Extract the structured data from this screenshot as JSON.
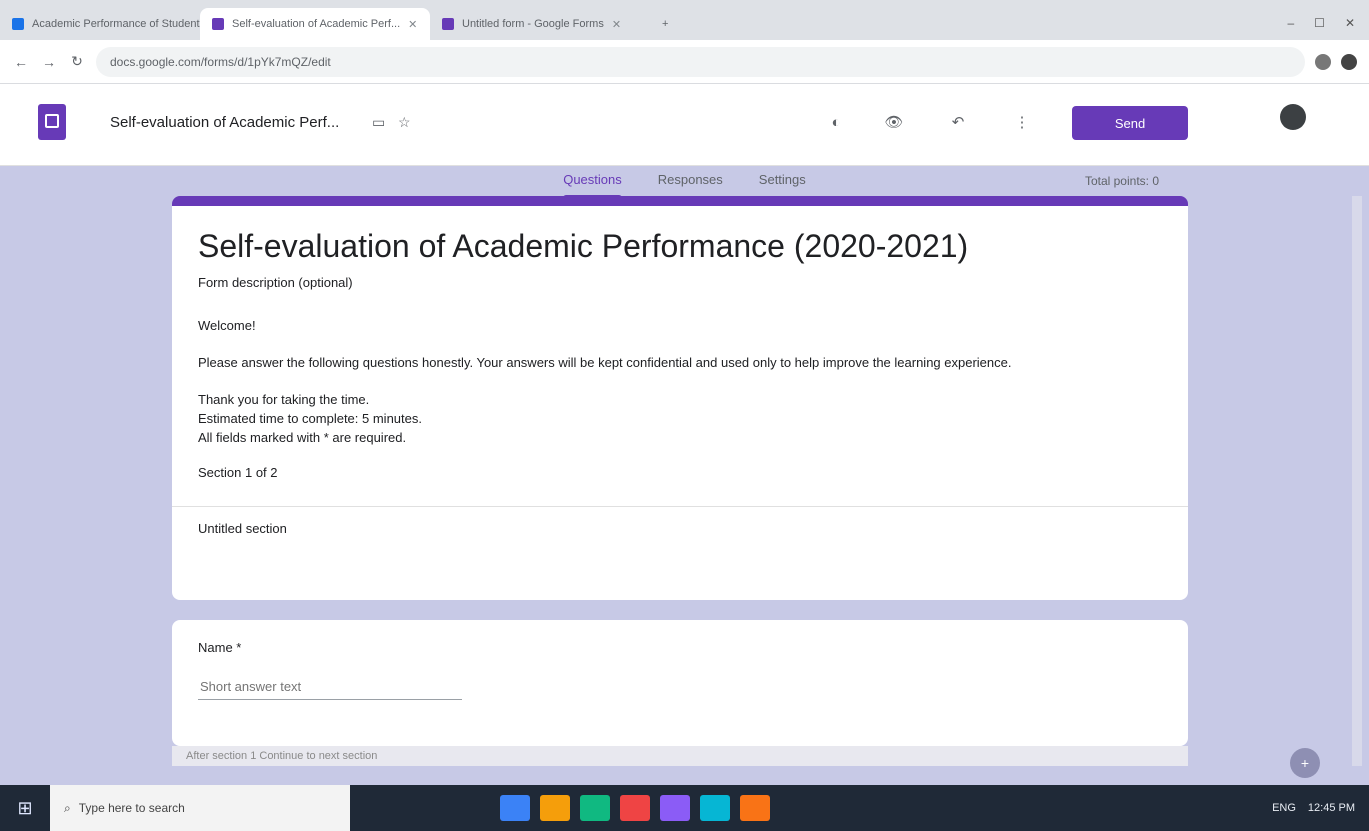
{
  "browser": {
    "tabs": [
      {
        "label": "Academic Performance of Students",
        "fav_color": "#1a73e8",
        "active": false
      },
      {
        "label": "Self-evaluation of Academic Perf...",
        "fav_color": "#673ab7",
        "active": true
      },
      {
        "label": "Untitled form - Google Forms",
        "fav_color": "#673ab7",
        "active": false
      }
    ],
    "new_tab": "+",
    "window_controls": [
      "–",
      "☐",
      "✕"
    ],
    "nav": {
      "back": "←",
      "forward": "→",
      "reload": "↻"
    },
    "url": "docs.google.com/forms/d/1pYk7mQZ/edit"
  },
  "header": {
    "doc_title": "Self-evaluation of Academic Perf...",
    "icons": [
      "folder-icon",
      "star-icon"
    ],
    "toolbar_icons": {
      "palette": "◐",
      "preview": "👁",
      "undo": "↶",
      "more": "⋮"
    },
    "send_label": "Send"
  },
  "form_tabs": [
    {
      "label": "Questions",
      "active": true
    },
    {
      "label": "Responses",
      "active": false
    },
    {
      "label": "Settings",
      "active": false
    }
  ],
  "total_points": "Total points: 0",
  "form": {
    "title": "Self-evaluation of Academic Performance (2020-2021)",
    "subtitle": "Form description (optional)",
    "heading": "Welcome!",
    "desc_p1": "Please answer the following questions honestly. Your answers will be kept confidential and used only to help improve the learning experience.",
    "desc_lines": [
      "Thank you for taking the time.",
      "Estimated time to complete: 5 minutes.",
      "All fields marked with * are required."
    ],
    "section_label": "Section 1 of 2",
    "footer": "Untitled section"
  },
  "question": {
    "label": "Name *",
    "placeholder": "Short answer text"
  },
  "bottom_strip": "After section 1 Continue to next section",
  "fab": "+",
  "taskbar": {
    "start": "⊞",
    "search_placeholder": "Type here to search",
    "apps": [
      "#3b82f6",
      "#f59e0b",
      "#10b981",
      "#ef4444",
      "#8b5cf6",
      "#06b6d4",
      "#f97316"
    ],
    "tray": [
      "ENG",
      "12:45 PM"
    ]
  }
}
